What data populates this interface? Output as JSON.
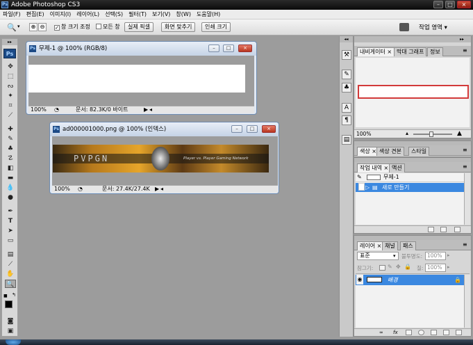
{
  "app": {
    "title": "Adobe Photoshop CS3",
    "logo": "Ps"
  },
  "window_controls": {
    "minimize": "–",
    "maximize": "□",
    "close": "×"
  },
  "menu": [
    "파일(F)",
    "편집(E)",
    "이미지(I)",
    "레이어(L)",
    "선택(S)",
    "필터(T)",
    "보기(V)",
    "창(W)",
    "도움말(H)"
  ],
  "options": {
    "zoom_in_icon": "⊕",
    "zoom_out_icon": "⊖",
    "resize_window": "창 크기 조정",
    "all_windows": "모든 창",
    "actual_pixels": "실제 픽셀",
    "fit_screen": "화면 맞추기",
    "print_size": "인쇄 크기",
    "workspace": "작업 영역 ▾"
  },
  "documents": [
    {
      "title": "무제-1 @ 100% (RGB/8)",
      "zoom": "100%",
      "status": "문서: 82.3K/0 바이트"
    },
    {
      "title": "ad000001000.png @ 100% (인덱스)",
      "zoom": "100%",
      "status": "문서: 27.4K/27.4K",
      "banner_logo": "PVPGN",
      "banner_text": "Player vs. Player Gaming Network"
    }
  ],
  "panels": {
    "navigator": {
      "tabs": [
        "내비게이터",
        "막대 그래프",
        "정보"
      ],
      "zoom": "100%"
    },
    "color": {
      "tabs": [
        "색상",
        "색상 견본",
        "스타일"
      ]
    },
    "history": {
      "tabs": [
        "작업 내역",
        "액션"
      ],
      "snapshot": "무제-1",
      "items": [
        "새로 만들기"
      ]
    },
    "layers": {
      "tabs": [
        "레이어",
        "채널",
        "패스"
      ],
      "blend_mode": "표준",
      "opacity_label": "불투명도:",
      "opacity": "100%",
      "lock_label": "잠그기:",
      "fill_label": "칠:",
      "fill": "100%",
      "layer_name": "배경"
    }
  },
  "colors": {
    "accent": "#3b88e0",
    "nav_box": "#d23a3a"
  }
}
